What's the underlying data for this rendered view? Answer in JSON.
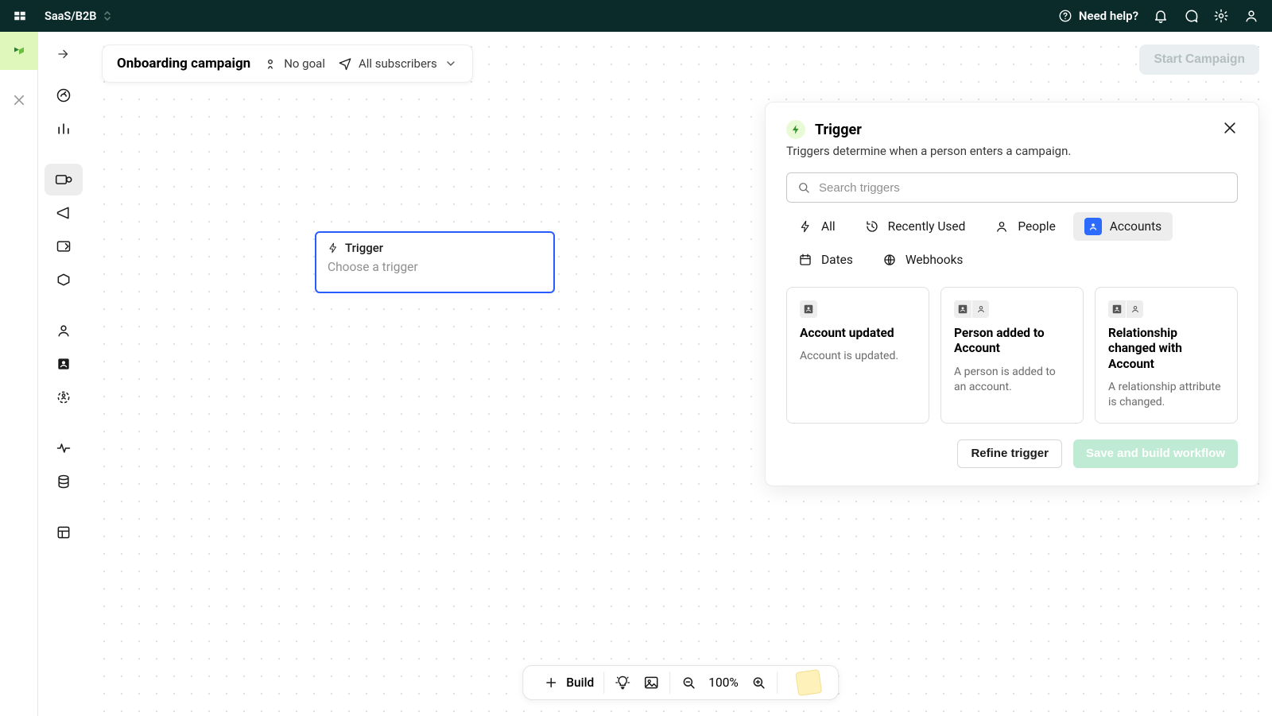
{
  "topbar": {
    "workspace": "SaaS/B2B",
    "need_help": "Need help?"
  },
  "header": {
    "title": "Onboarding campaign",
    "goal": "No goal",
    "audience": "All subscribers"
  },
  "start_button": "Start Campaign",
  "canvas_node": {
    "title": "Trigger",
    "subtitle": "Choose a trigger"
  },
  "panel": {
    "title": "Trigger",
    "subtitle": "Triggers determine when a person enters a campaign.",
    "search_placeholder": "Search triggers",
    "tabs": {
      "all": "All",
      "recent": "Recently Used",
      "people": "People",
      "accounts": "Accounts",
      "dates": "Dates",
      "webhooks": "Webhooks"
    },
    "active_tab": "accounts",
    "cards": [
      {
        "title": "Account updated",
        "desc": "Account is updated."
      },
      {
        "title": "Person added to Account",
        "desc": "A person is added to an account."
      },
      {
        "title": "Relationship changed with Account",
        "desc": "A relationship attribute is changed."
      }
    ],
    "refine": "Refine trigger",
    "save": "Save and build workflow"
  },
  "bottombar": {
    "build": "Build",
    "zoom": "100%"
  }
}
